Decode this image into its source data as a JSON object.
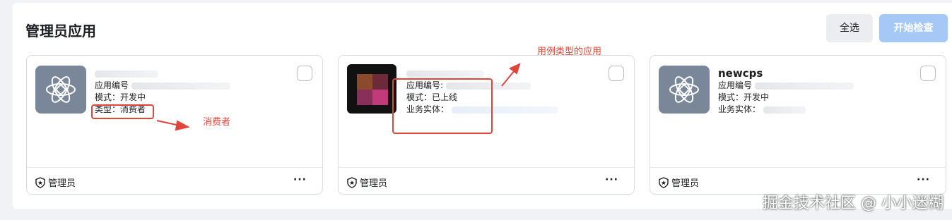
{
  "page": {
    "title": "管理员应用"
  },
  "toolbar": {
    "select_all": "全选",
    "start_check": "开始检查"
  },
  "cards": [
    {
      "name": "",
      "app_id_label": "应用编号",
      "mode": "模式：开发中",
      "line3": "类型：消费者",
      "role": "管理员",
      "more": "···"
    },
    {
      "name": "",
      "app_id_label": "应用编号:",
      "mode": "模式：已上线",
      "line3": "业务实体：",
      "role": "管理员",
      "more": "···"
    },
    {
      "name": "newcps",
      "app_id_label": "应用编号",
      "mode": "模式：开发中",
      "line3": "业务实体：",
      "role": "管理员",
      "more": "···"
    }
  ],
  "annotations": {
    "consumer": "消费者",
    "use_case": "用例类型的应用"
  },
  "watermark": "掘金技术社区 @ 小小迷糊",
  "colors": {
    "primary_disabled": "#a6c8f7",
    "annotation": "#e0453a",
    "icon_bg": "#7a8799"
  }
}
